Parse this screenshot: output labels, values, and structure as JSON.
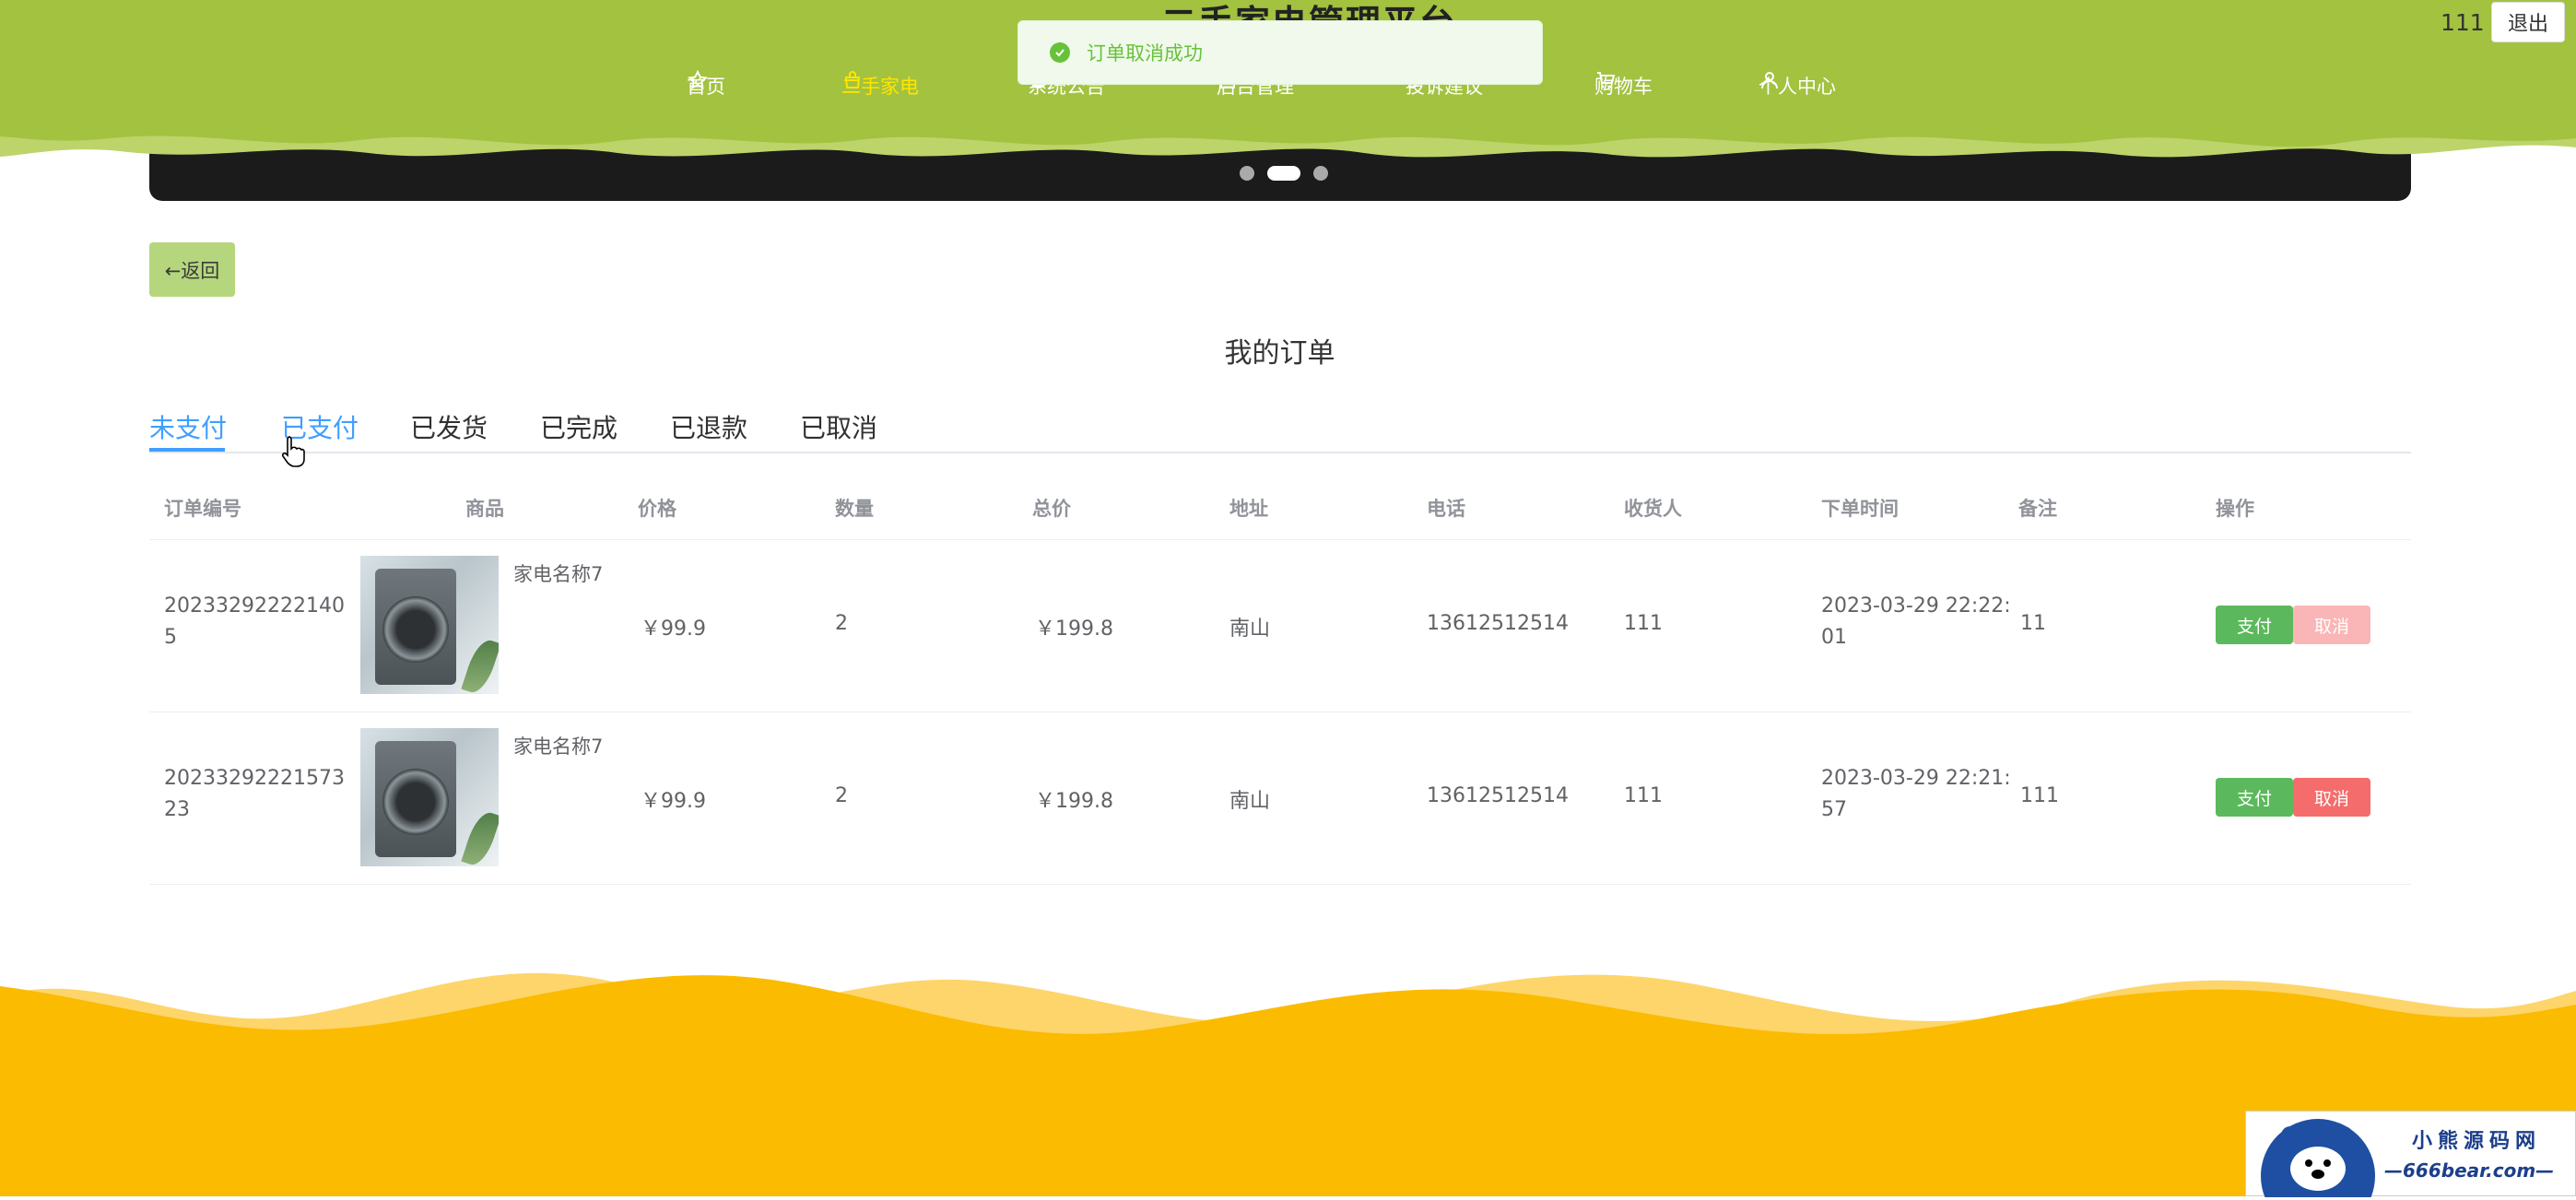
{
  "header": {
    "site_title": "二手家电管理平台",
    "nav": [
      {
        "label": "首页",
        "icon": "star-icon",
        "active": false
      },
      {
        "label": "二手家电",
        "icon": "bag-icon",
        "active": true
      },
      {
        "label": "系统公告",
        "icon": "info-icon",
        "active": false
      },
      {
        "label": "后台管理",
        "icon": "doc-icon",
        "active": false
      },
      {
        "label": "投诉建议",
        "icon": "link-icon",
        "active": false
      },
      {
        "label": "购物车",
        "icon": "cart-icon",
        "active": false
      },
      {
        "label": "个人中心",
        "icon": "user-icon",
        "active": false
      }
    ],
    "user_name": "111",
    "logout_label": "退出"
  },
  "toast": {
    "message": "订单取消成功",
    "icon": "check-circle-icon"
  },
  "back_label": "←返回",
  "page_title": "我的订单",
  "tabs": [
    {
      "label": "未支付",
      "active": true
    },
    {
      "label": "已支付",
      "active": false
    },
    {
      "label": "已发货",
      "active": false
    },
    {
      "label": "已完成",
      "active": false
    },
    {
      "label": "已退款",
      "active": false
    },
    {
      "label": "已取消",
      "active": false
    }
  ],
  "table": {
    "columns": [
      "订单编号",
      "商品",
      "价格",
      "数量",
      "总价",
      "地址",
      "电话",
      "收货人",
      "下单时间",
      "备注",
      "操作"
    ],
    "rows": [
      {
        "order_no_line1": "20233292222140",
        "order_no_line2": "5",
        "product_name": "家电名称7",
        "price": "￥99.9",
        "quantity": "2",
        "total": "￥199.8",
        "address": "南山",
        "phone": "13612512514",
        "receiver": "111",
        "time_line1": "2023-03-29 22:22:",
        "time_line2": "01",
        "remark": "11",
        "pay_label": "支付",
        "cancel_label": "取消"
      },
      {
        "order_no_line1": "20233292221573",
        "order_no_line2": "23",
        "product_name": "家电名称7",
        "price": "￥99.9",
        "quantity": "2",
        "total": "￥199.8",
        "address": "南山",
        "phone": "13612512514",
        "receiver": "111",
        "time_line1": "2023-03-29 22:21:",
        "time_line2": "57",
        "remark": "111",
        "pay_label": "支付",
        "cancel_label": "取消"
      }
    ]
  },
  "watermark": {
    "title": "小熊源码网",
    "subtitle": "—666bear.com—"
  },
  "colors": {
    "header_green": "#a3c240",
    "footer_yellow": "#fbbb00",
    "accent_blue": "#409eff",
    "pay_green": "#5cb85c",
    "cancel_red": "#f56c6c"
  }
}
